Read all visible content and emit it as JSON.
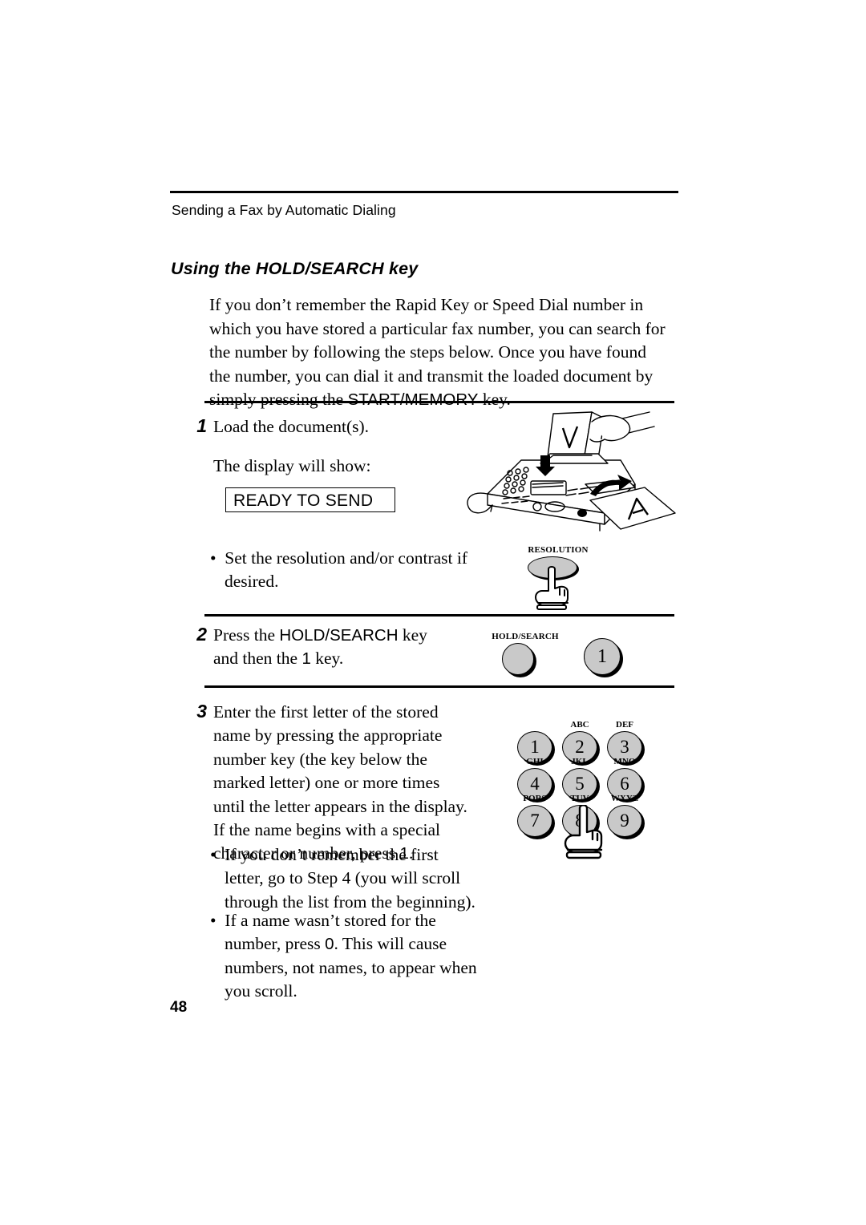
{
  "page": {
    "running_head": "Sending a Fax by Automatic Dialing",
    "section_title": "Using the HOLD/SEARCH key",
    "page_number": "48"
  },
  "intro": {
    "text_before_key": "If you don’t remember the Rapid Key or Speed Dial number in which you have stored a particular fax number, you can search for the number by following the steps below. Once you have found the number, you can dial it and transmit the loaded document by simply pressing the ",
    "key_name": "START/MEMORY",
    "text_after_key": " key."
  },
  "steps": [
    {
      "number": "1",
      "line1": "Load the document(s).",
      "line2": "The display will show:",
      "display_text": "READY TO SEND",
      "bullet": "Set the resolution and/or contrast if desired."
    },
    {
      "number": "2",
      "text_before_key": "Press the ",
      "key_name": "HOLD/SEARCH",
      "text_middle": " key and then the ",
      "key_digit": "1",
      "text_after": " key."
    },
    {
      "number": "3",
      "text_before_digit": "Enter the first letter of the stored name by pressing the appropriate number key (the key below the marked letter) one or more times until the letter appears in the display. If the name begins with a special character or number, press ",
      "digit": "1",
      "text_after_digit": ".",
      "bullets": [
        {
          "text": "If you don’t remember the first letter, go to Step 4 (you will scroll through the list from the beginning)."
        },
        {
          "before_digit": "If a name wasn’t stored for the number, press ",
          "digit": "0",
          "after_digit": ". This will cause numbers, not names, to appear when you scroll."
        }
      ]
    }
  ],
  "illustrations": {
    "resolution": {
      "label": "RESOLUTION"
    },
    "hold_search": {
      "label": "HOLD/SEARCH",
      "key_one_digit": "1"
    },
    "keypad": {
      "keys": [
        {
          "digit": "1",
          "letters": ""
        },
        {
          "digit": "2",
          "letters": "ABC"
        },
        {
          "digit": "3",
          "letters": "DEF"
        },
        {
          "digit": "4",
          "letters": "GHI"
        },
        {
          "digit": "5",
          "letters": "JKL"
        },
        {
          "digit": "6",
          "letters": "MNO"
        },
        {
          "digit": "7",
          "letters": "PQRS"
        },
        {
          "digit": "8",
          "letters": "TUV"
        },
        {
          "digit": "9",
          "letters": "WXYZ"
        }
      ]
    },
    "fax_machine": {
      "document_letter_top": "V",
      "document_letter_bottom": "A"
    }
  },
  "colors": {
    "key_fill": "#c9c9c9",
    "ink": "#000000",
    "paper": "#ffffff"
  }
}
